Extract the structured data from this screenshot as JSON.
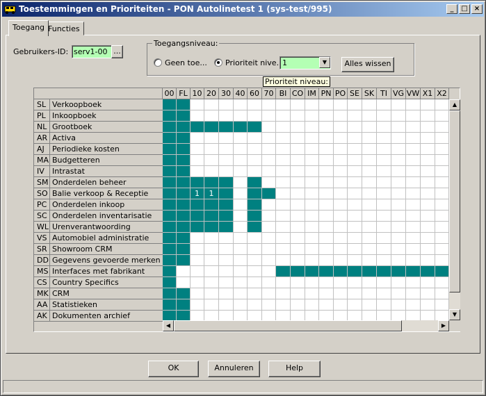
{
  "window": {
    "title": "Toestemmingen en Prioriteiten - PON Autolinetest 1 (sys-test/995)",
    "minimize": "_",
    "maximize": "□",
    "close": "×"
  },
  "tabs": [
    {
      "label": "Toegang",
      "active": true
    },
    {
      "label": "Functies",
      "active": false
    }
  ],
  "user": {
    "label": "Gebruikers-ID:",
    "value": "serv1-00",
    "browse": "..."
  },
  "access_level": {
    "group_label": "Toegangsniveau:",
    "option_none": "Geen toe...",
    "option_priority": "Prioriteit nive...",
    "selected": "priority",
    "priority_value": "1",
    "clear_button": "Alles wissen",
    "tooltip": "Prioriteit niveau:"
  },
  "grid": {
    "columns": [
      "00",
      "FL",
      "10",
      "20",
      "30",
      "40",
      "60",
      "70",
      "BI",
      "CO",
      "IM",
      "PN",
      "PO",
      "SE",
      "SK",
      "TI",
      "VG",
      "VW",
      "X1",
      "X2"
    ],
    "rows": [
      {
        "code": "SL",
        "name": "Verkoopboek",
        "on": [
          0,
          1
        ],
        "labels": {}
      },
      {
        "code": "PL",
        "name": "Inkoopboek",
        "on": [
          0,
          1
        ],
        "labels": {}
      },
      {
        "code": "NL",
        "name": "Grootboek",
        "on": [
          0,
          1,
          2,
          3,
          4,
          5,
          6
        ],
        "labels": {}
      },
      {
        "code": "AR",
        "name": "Activa",
        "on": [
          0,
          1
        ],
        "labels": {}
      },
      {
        "code": "AJ",
        "name": "Periodieke kosten",
        "on": [
          0,
          1
        ],
        "labels": {}
      },
      {
        "code": "MA",
        "name": "Budgetteren",
        "on": [
          0,
          1
        ],
        "labels": {}
      },
      {
        "code": "IV",
        "name": "Intrastat",
        "on": [
          0,
          1
        ],
        "labels": {}
      },
      {
        "code": "SM",
        "name": "Onderdelen beheer",
        "on": [
          0,
          1,
          2,
          3,
          4,
          6
        ],
        "labels": {}
      },
      {
        "code": "SO",
        "name": "Balie verkoop & Receptie",
        "on": [
          0,
          1,
          2,
          3,
          4,
          6,
          7
        ],
        "labels": {
          "2": "1",
          "3": "1"
        }
      },
      {
        "code": "PC",
        "name": "Onderdelen inkoop",
        "on": [
          0,
          1,
          2,
          3,
          4,
          6
        ],
        "labels": {}
      },
      {
        "code": "SC",
        "name": "Onderdelen inventarisatie",
        "on": [
          0,
          1,
          2,
          3,
          4,
          6
        ],
        "labels": {}
      },
      {
        "code": "WL",
        "name": "Urenverantwoording",
        "on": [
          0,
          1,
          2,
          3,
          4,
          6
        ],
        "labels": {}
      },
      {
        "code": "VS",
        "name": "Automobiel administratie",
        "on": [
          0,
          1
        ],
        "labels": {}
      },
      {
        "code": "SR",
        "name": "Showroom CRM",
        "on": [
          0,
          1
        ],
        "labels": {}
      },
      {
        "code": "DD",
        "name": "Gegevens gevoerde merken",
        "on": [
          0,
          1
        ],
        "labels": {}
      },
      {
        "code": "MS",
        "name": "Interfaces met fabrikant",
        "on": [
          0,
          8,
          9,
          10,
          11,
          12,
          13,
          14,
          15,
          16,
          17,
          18,
          19
        ],
        "labels": {}
      },
      {
        "code": "CS",
        "name": "Country Specifics",
        "on": [
          0
        ],
        "labels": {}
      },
      {
        "code": "MK",
        "name": "CRM",
        "on": [
          0,
          1
        ],
        "labels": {}
      },
      {
        "code": "AA",
        "name": "Statistieken",
        "on": [
          0,
          1
        ],
        "labels": {}
      },
      {
        "code": "AK",
        "name": "Dokumenten archief",
        "on": [
          0,
          1
        ],
        "labels": {}
      }
    ]
  },
  "buttons": {
    "ok": "OK",
    "cancel": "Annuleren",
    "help": "Help"
  },
  "colors": {
    "granted": "#008080",
    "title_start": "#0a246a",
    "title_end": "#a6caf0",
    "field_bg": "#b4ffb4"
  }
}
